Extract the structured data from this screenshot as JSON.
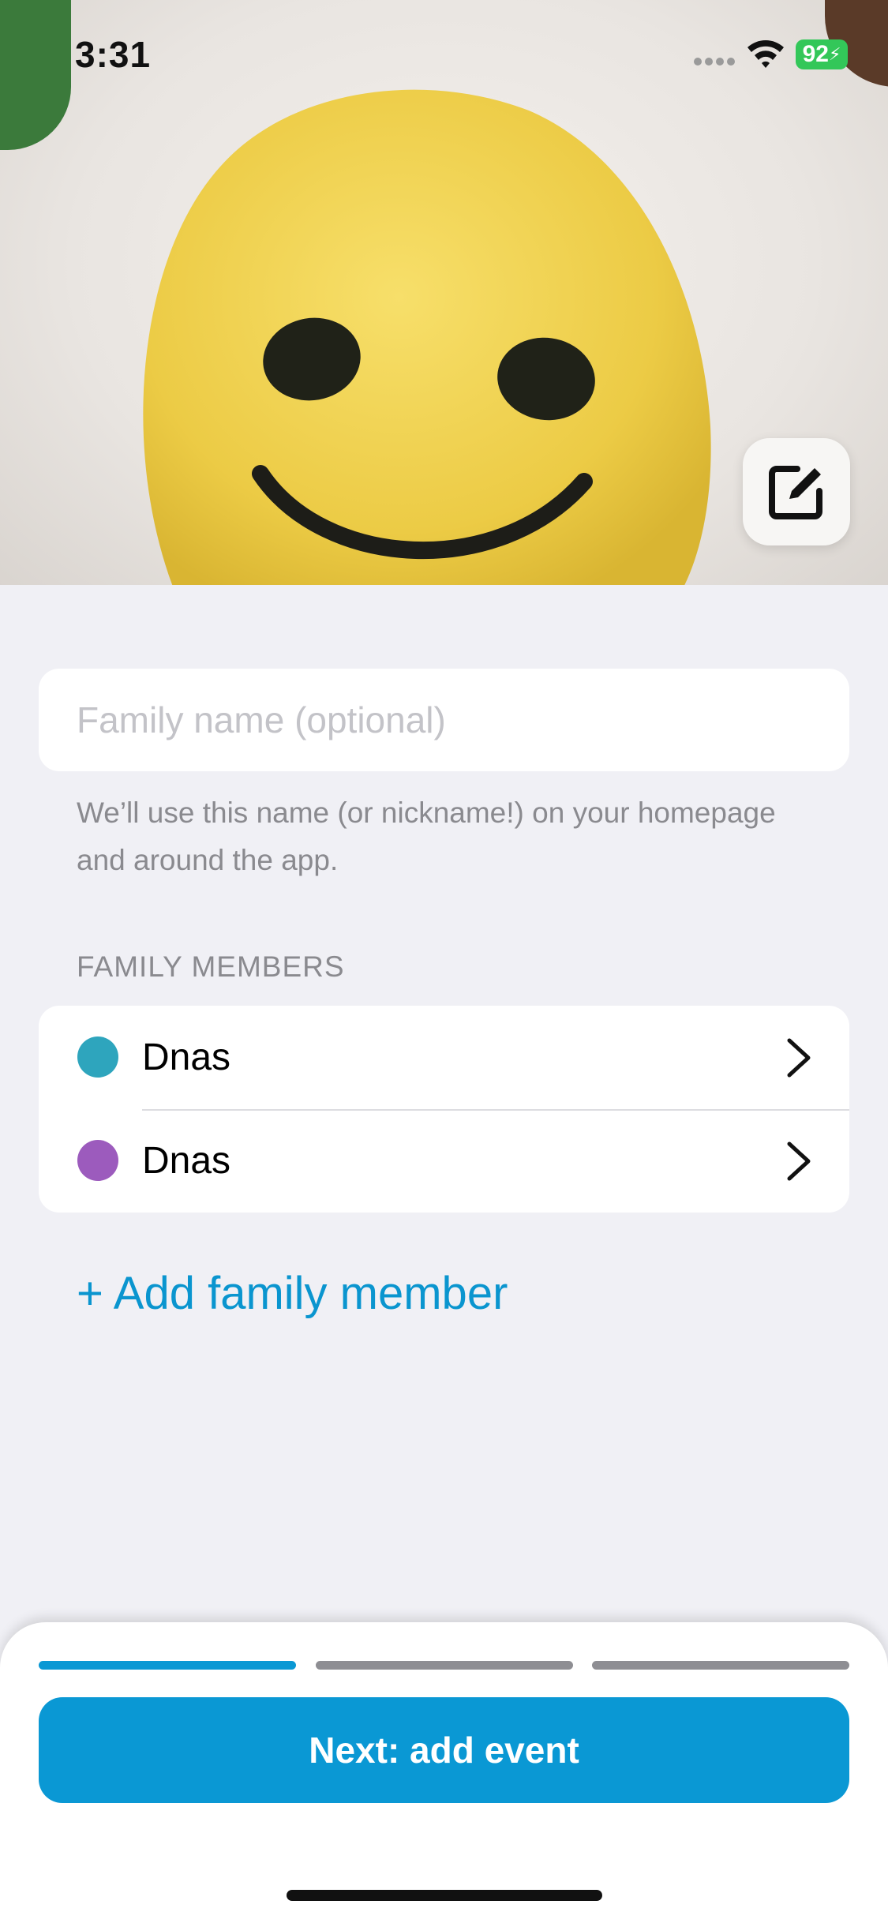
{
  "status_bar": {
    "time": "3:31",
    "battery": "92"
  },
  "hero": {
    "edit_icon": "edit-square-icon"
  },
  "form": {
    "family_name_value": "",
    "family_name_placeholder": "Family name (optional)",
    "helper_text": "We’ll use this name (or nickname!) on your homepage and around the app."
  },
  "members_section": {
    "header": "FAMILY MEMBERS",
    "members": [
      {
        "name": "Dnas",
        "color": "#2ea5bd"
      },
      {
        "name": "Dnas",
        "color": "#9c5bbd"
      }
    ],
    "add_label": "+ Add family member"
  },
  "bottom_sheet": {
    "step_current": 1,
    "step_total": 3,
    "active_color": "#0a98d4",
    "inactive_color": "#8e8e93",
    "next_label": "Next: add event"
  }
}
